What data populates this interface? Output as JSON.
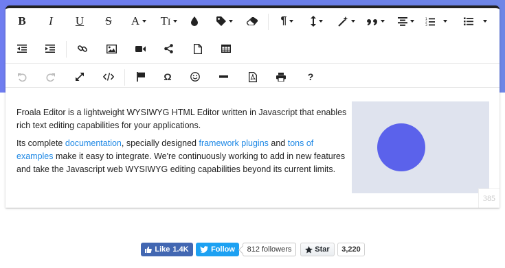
{
  "toolbar": {
    "row1": [
      {
        "name": "bold-button",
        "glyph": "B"
      },
      {
        "name": "italic-button",
        "glyph": "I"
      },
      {
        "name": "underline-button",
        "glyph": "U"
      },
      {
        "name": "strikethrough-button",
        "glyph": "S"
      },
      {
        "name": "font-family-button",
        "glyph": "A"
      },
      {
        "name": "font-size-button",
        "glyph": "T"
      }
    ]
  },
  "content": {
    "para1": "Froala Editor is a lightweight WYSIWYG HTML Editor written in Javascript that enables rich text editing capabilities for your applications.",
    "para2_start": "Its complete ",
    "link_docs": "documentation",
    "para2_mid1": ", specially designed ",
    "link_plugins": "framework plugins",
    "para2_mid2": " and ",
    "link_examples": "tons of examples",
    "para2_end": " make it easy to integrate. We're continuously working to add in new features and take the Javascript web WYSIWYG editing capabilities beyond its current limits.",
    "image_circle_color": "#5b62eb",
    "image_bg_color": "#dfe3ee"
  },
  "char_counter": "385",
  "social": {
    "fb_like_label": "Like",
    "fb_like_count": "1.4K",
    "tw_follow_label": "Follow",
    "tw_followers": "812 followers",
    "gh_star_label": "Star",
    "gh_star_count": "3,220"
  },
  "colors": {
    "accent_gradient": "#6f7df0",
    "link": "#1e88e5",
    "facebook": "#4267b2",
    "twitter": "#1da1f2"
  }
}
